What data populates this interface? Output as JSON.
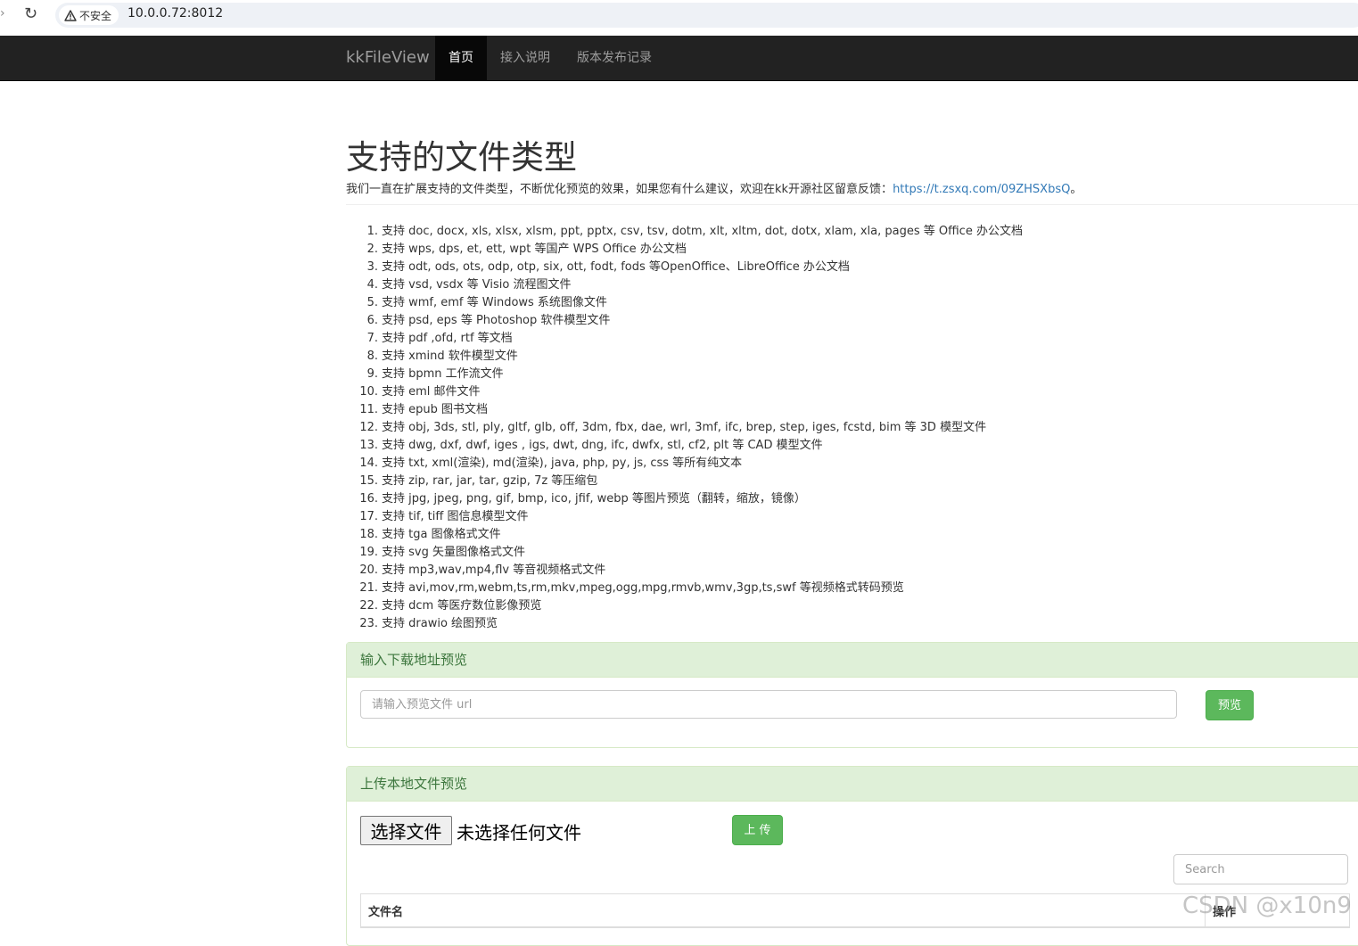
{
  "browser": {
    "security_label": "不安全",
    "url": "10.0.0.72:8012"
  },
  "navbar": {
    "brand": "kkFileView",
    "items": [
      {
        "label": "首页",
        "active": true
      },
      {
        "label": "接入说明",
        "active": false
      },
      {
        "label": "版本发布记录",
        "active": false
      }
    ]
  },
  "main": {
    "title": "支持的文件类型",
    "intro_text": "我们一直在扩展支持的文件类型，不断优化预览的效果，如果您有什么建议，欢迎在kk开源社区留意反馈：",
    "intro_link": "https://t.zsxq.com/09ZHSXbsQ",
    "intro_suffix": "。",
    "formats": [
      "支持 doc, docx, xls, xlsx, xlsm, ppt, pptx, csv, tsv, dotm, xlt, xltm, dot, dotx, xlam, xla, pages 等 Office 办公文档",
      "支持 wps, dps, et, ett, wpt 等国产 WPS Office 办公文档",
      "支持 odt, ods, ots, odp, otp, six, ott, fodt, fods 等OpenOffice、LibreOffice 办公文档",
      "支持 vsd, vsdx 等 Visio 流程图文件",
      "支持 wmf, emf 等 Windows 系统图像文件",
      "支持 psd, eps 等 Photoshop 软件模型文件",
      "支持 pdf ,ofd, rtf 等文档",
      "支持 xmind 软件模型文件",
      "支持 bpmn 工作流文件",
      "支持 eml 邮件文件",
      "支持 epub 图书文档",
      "支持 obj, 3ds, stl, ply, gltf, glb, off, 3dm, fbx, dae, wrl, 3mf, ifc, brep, step, iges, fcstd, bim 等 3D 模型文件",
      "支持 dwg, dxf, dwf, iges , igs, dwt, dng, ifc, dwfx, stl, cf2, plt 等 CAD 模型文件",
      "支持 txt, xml(渲染), md(渲染), java, php, py, js, css 等所有纯文本",
      "支持 zip, rar, jar, tar, gzip, 7z 等压缩包",
      "支持 jpg, jpeg, png, gif, bmp, ico, jfif, webp 等图片预览（翻转，缩放，镜像）",
      "支持 tif, tiff 图信息模型文件",
      "支持 tga 图像格式文件",
      "支持 svg 矢量图像格式文件",
      "支持 mp3,wav,mp4,flv 等音视频格式文件",
      "支持 avi,mov,rm,webm,ts,rm,mkv,mpeg,ogg,mpg,rmvb,wmv,3gp,ts,swf 等视频格式转码预览",
      "支持 dcm 等医疗数位影像预览",
      "支持 drawio 绘图预览"
    ]
  },
  "url_panel": {
    "heading": "输入下载地址预览",
    "placeholder": "请输入预览文件 url",
    "button": "预览"
  },
  "upload_panel": {
    "heading": "上传本地文件预览",
    "choose_button": "选择文件",
    "no_file_text": "未选择任何文件",
    "upload_button": "上 传",
    "search_placeholder": "Search",
    "table_headers": [
      "文件名",
      "操作"
    ]
  },
  "watermark": "CSDN @x10n9",
  "colors": {
    "navbar_bg": "#222222",
    "panel_heading_bg": "#dff0d8",
    "panel_heading_text": "#3c763d",
    "button_success": "#5cb85c",
    "link": "#337ab7"
  }
}
